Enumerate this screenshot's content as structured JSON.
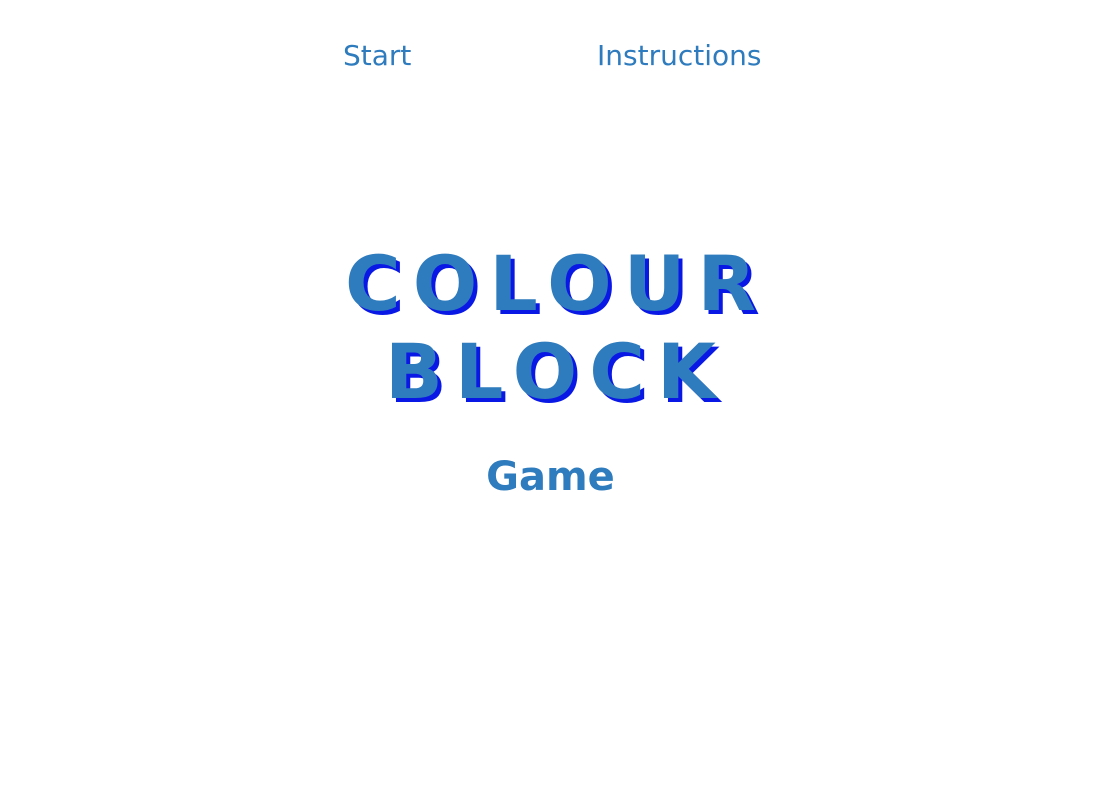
{
  "nav": {
    "start_label": "Start",
    "instructions_label": "Instructions"
  },
  "title": {
    "line1": "COLOUR",
    "line2": "BLOCK"
  },
  "subtitle": "Game",
  "colors": {
    "primary_blue": "#2e7bbd",
    "shadow_blue": "#0a18e6",
    "background": "#ffffff"
  }
}
